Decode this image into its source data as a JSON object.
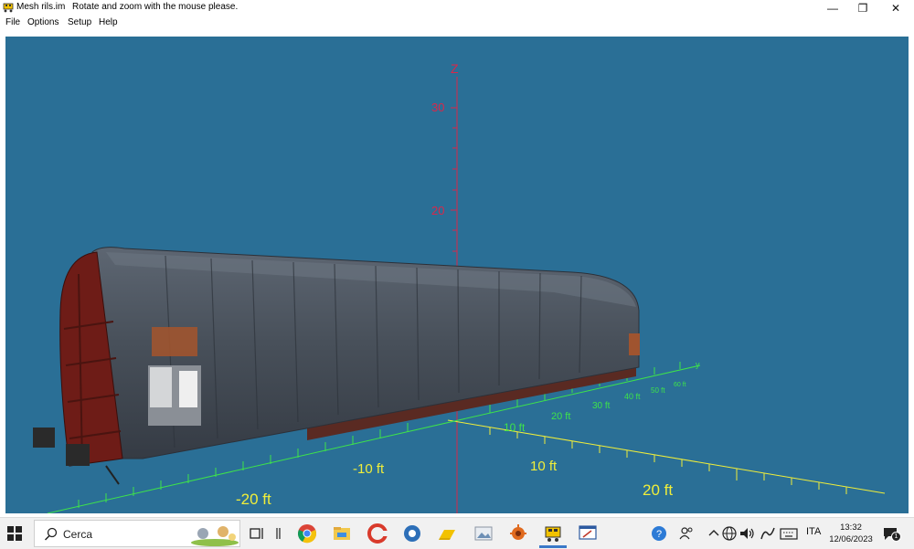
{
  "window": {
    "title": "Mesh rils.im",
    "hint": "Rotate and zoom with the mouse please.",
    "controls": {
      "minimize": "—",
      "restore": "❐",
      "close": "✕"
    }
  },
  "menu": [
    "File",
    "Options",
    "Setup",
    "Help"
  ],
  "viewport": {
    "background": "#2a6f96",
    "z_axis": {
      "label": "Z",
      "ticks": [
        "30",
        "20"
      ],
      "color": "#d8284a"
    },
    "x_axis": {
      "labels": [
        "-20 ft",
        "-10 ft",
        "10 ft",
        "20 ft"
      ],
      "color": "#f0ee3a"
    },
    "y_axis": {
      "label": "y",
      "labels": [
        "10 ft",
        "20 ft",
        "30 ft",
        "40 ft",
        "50 ft",
        "60 ft"
      ],
      "color": "#3ee34a"
    },
    "model": "freight wagon with tarpaulin cover"
  },
  "taskbar": {
    "search_placeholder": "Cerca",
    "apps": [
      "task-view",
      "separator",
      "chrome",
      "file-explorer",
      "ccleaner",
      "app-blue",
      "folder-yellow",
      "photos",
      "game",
      "mesh-viewer",
      "editor"
    ],
    "tray": {
      "language": "ITA"
    },
    "clock": {
      "time": "13:32",
      "date": "12/06/2023"
    },
    "notification_count": "1"
  }
}
